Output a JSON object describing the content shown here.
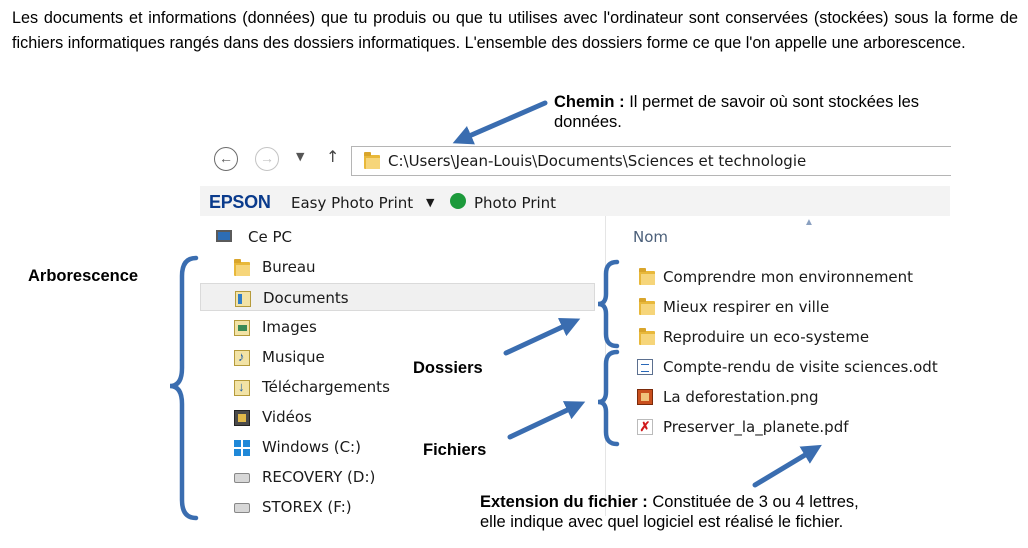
{
  "intro": "Les documents et informations (données) que tu produis ou que tu utilises avec l'ordinateur sont conservées (stockées) sous la forme de fichiers informatiques rangés dans des dossiers informatiques. L'ensemble des dossiers forme ce que l'on appelle une arborescence.",
  "annotations": {
    "chemin_title": "Chemin :",
    "chemin_text": "Il permet de savoir où sont stockées les données.",
    "arborescence": "Arborescence",
    "dossiers": "Dossiers",
    "fichiers": "Fichiers",
    "extension_title": "Extension du fichier :",
    "extension_text_1": "Constituée de 3 ou 4 lettres,",
    "extension_text_2": "elle indique avec quel logiciel est réalisé le fichier."
  },
  "explorer": {
    "address_path": "C:\\Users\\Jean-Louis\\Documents\\Sciences et technologie",
    "back_icon": "back-arrow-icon",
    "forward_icon": "forward-arrow-icon",
    "toolbar": {
      "brand": "EPSON",
      "easy_photo_print": "Easy Photo Print",
      "photo_print": "Photo Print"
    },
    "nav_pane": {
      "root": "Ce PC",
      "items": [
        {
          "label": "Bureau",
          "icon": "folder-icon"
        },
        {
          "label": "Documents",
          "icon": "documents-library-icon",
          "selected": true
        },
        {
          "label": "Images",
          "icon": "images-library-icon"
        },
        {
          "label": "Musique",
          "icon": "music-library-icon"
        },
        {
          "label": "Téléchargements",
          "icon": "downloads-icon"
        },
        {
          "label": "Vidéos",
          "icon": "videos-library-icon"
        },
        {
          "label": "Windows (C:)",
          "icon": "windows-drive-icon"
        },
        {
          "label": "RECOVERY (D:)",
          "icon": "drive-icon"
        },
        {
          "label": "STOREX (F:)",
          "icon": "drive-icon"
        }
      ]
    },
    "content": {
      "column_header": "Nom",
      "folders": [
        "Comprendre mon environnement",
        "Mieux respirer en ville",
        "Reproduire un eco-systeme"
      ],
      "files": [
        {
          "name": "Compte-rendu de visite sciences.odt",
          "icon": "odt-document-icon"
        },
        {
          "name": "La deforestation.png",
          "icon": "png-image-icon"
        },
        {
          "name": "Preserver_la_planete.pdf",
          "icon": "pdf-icon"
        }
      ]
    }
  },
  "colors": {
    "arrow": "#3a6db0",
    "accent_brand": "#0a3b8c"
  }
}
